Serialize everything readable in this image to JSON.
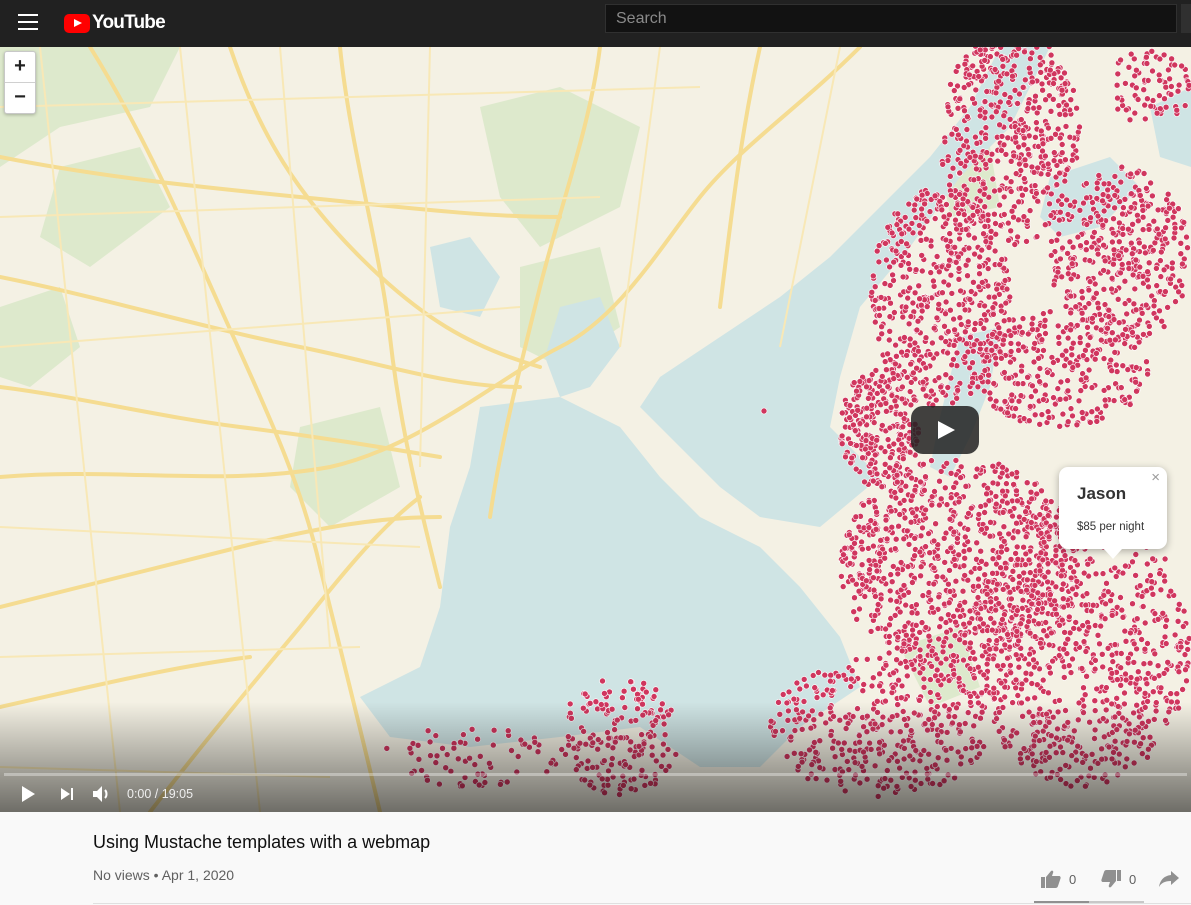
{
  "header": {
    "logo_text": "YouTube",
    "search_placeholder": "Search"
  },
  "map": {
    "zoom_in_label": "+",
    "zoom_out_label": "−",
    "popup": {
      "name": "Jason",
      "price": "$85 per night",
      "close_label": "×"
    },
    "colors": {
      "land": "#f4f1e4",
      "water": "#cfe4e4",
      "park": "#dde9cc",
      "road": "#f5dc91",
      "listing_marker": "#d0365e"
    }
  },
  "player": {
    "time": "0:00 / 19:05",
    "progress": 0
  },
  "video": {
    "title": "Using Mustache templates with a webmap",
    "meta": "No views • Apr 1, 2020",
    "likes": "0",
    "dislikes": "0"
  }
}
